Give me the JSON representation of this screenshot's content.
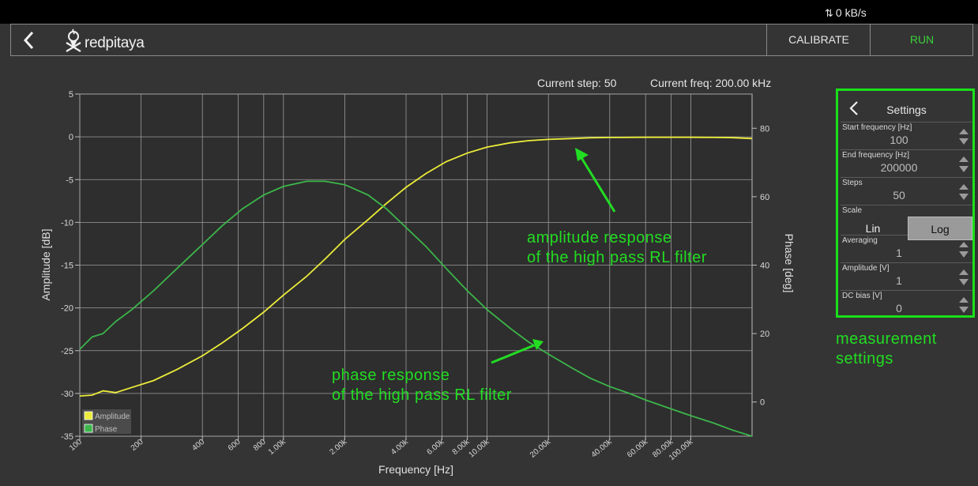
{
  "netrate": {
    "text": "0 kB/s"
  },
  "toolbar": {
    "logo_text": "redpitaya",
    "calibrate_label": "CALIBRATE",
    "run_label": "RUN",
    "run_color": "#3ad13a"
  },
  "status": {
    "current_step": "Current step: 50",
    "current_freq": "Current freq: 200.00 kHz"
  },
  "settings": {
    "title": "Settings",
    "start_frequency": {
      "label": "Start frequency [Hz]",
      "value": "100"
    },
    "end_frequency": {
      "label": "End frequency [Hz]",
      "value": "200000"
    },
    "steps": {
      "label": "Steps",
      "value": "50"
    },
    "scale": {
      "label": "Scale",
      "options": [
        "Lin",
        "Log"
      ],
      "selected": "Log"
    },
    "averaging": {
      "label": "Averaging",
      "value": "1"
    },
    "amplitude": {
      "label": "Amplitude [V]",
      "value": "1"
    },
    "dc_bias": {
      "label": "DC bias [V]",
      "value": "0"
    },
    "border_color": "#19e019"
  },
  "annotations": {
    "amplitude_line1": "amplitude response",
    "amplitude_line2": "of the high pass RL filter",
    "phase_line1": "phase response",
    "phase_line2": "of the high pass RL filter",
    "settings_line1": "measurement",
    "settings_line2": "settings",
    "color": "#22dd22"
  },
  "chart_data": {
    "type": "line",
    "xlabel": "Frequency [Hz]",
    "ylabel": "Amplitude [dB]",
    "y2label": "Phase [deg]",
    "xscale": "log",
    "xlim": [
      100,
      200000
    ],
    "ylim": [
      -35,
      5
    ],
    "y2lim": [
      -10,
      90
    ],
    "grid": true,
    "legend_position": "bottom-left",
    "x_ticks": [
      {
        "v": 100,
        "label": "100"
      },
      {
        "v": 200,
        "label": "200"
      },
      {
        "v": 400,
        "label": "400"
      },
      {
        "v": 600,
        "label": "600"
      },
      {
        "v": 800,
        "label": "800"
      },
      {
        "v": 1000,
        "label": "1.00k"
      },
      {
        "v": 2000,
        "label": "2.00k"
      },
      {
        "v": 4000,
        "label": "4.00k"
      },
      {
        "v": 6000,
        "label": "6.00k"
      },
      {
        "v": 8000,
        "label": "8.00k"
      },
      {
        "v": 10000,
        "label": "10.00k"
      },
      {
        "v": 20000,
        "label": "20.00k"
      },
      {
        "v": 40000,
        "label": "40.00k"
      },
      {
        "v": 60000,
        "label": "60.00k"
      },
      {
        "v": 80000,
        "label": "80.00k"
      },
      {
        "v": 100000,
        "label": "100.00k"
      }
    ],
    "y_ticks": [
      5,
      0,
      -5,
      -10,
      -15,
      -20,
      -25,
      -30,
      -35
    ],
    "y2_ticks": [
      80,
      60,
      40,
      20,
      0
    ],
    "series": [
      {
        "name": "Amplitude",
        "axis": "left",
        "color": "#ecec3a",
        "points": [
          [
            100,
            -30.3
          ],
          [
            115,
            -30.2
          ],
          [
            130,
            -29.7
          ],
          [
            150,
            -29.9
          ],
          [
            180,
            -29.3
          ],
          [
            230,
            -28.5
          ],
          [
            300,
            -27.2
          ],
          [
            400,
            -25.6
          ],
          [
            500,
            -24.1
          ],
          [
            630,
            -22.4
          ],
          [
            800,
            -20.5
          ],
          [
            1000,
            -18.5
          ],
          [
            1300,
            -16.3
          ],
          [
            1600,
            -14.3
          ],
          [
            2000,
            -12.0
          ],
          [
            2600,
            -9.7
          ],
          [
            3200,
            -7.8
          ],
          [
            4000,
            -5.9
          ],
          [
            5000,
            -4.3
          ],
          [
            6300,
            -2.9
          ],
          [
            8000,
            -1.9
          ],
          [
            10000,
            -1.2
          ],
          [
            13000,
            -0.7
          ],
          [
            16000,
            -0.45
          ],
          [
            20000,
            -0.3
          ],
          [
            26000,
            -0.2
          ],
          [
            32000,
            -0.12
          ],
          [
            40000,
            -0.08
          ],
          [
            60000,
            -0.05
          ],
          [
            80000,
            -0.05
          ],
          [
            100000,
            -0.05
          ],
          [
            130000,
            -0.07
          ],
          [
            160000,
            -0.1
          ],
          [
            200000,
            -0.2
          ]
        ]
      },
      {
        "name": "Phase",
        "axis": "right",
        "color": "#3cb64a",
        "points": [
          [
            100,
            15.4
          ],
          [
            115,
            19.0
          ],
          [
            130,
            20.0
          ],
          [
            150,
            23.5
          ],
          [
            180,
            27.0
          ],
          [
            230,
            32.5
          ],
          [
            300,
            39.0
          ],
          [
            400,
            46.0
          ],
          [
            500,
            51.5
          ],
          [
            630,
            56.5
          ],
          [
            800,
            60.5
          ],
          [
            1000,
            63.0
          ],
          [
            1300,
            64.5
          ],
          [
            1600,
            64.5
          ],
          [
            2000,
            63.5
          ],
          [
            2600,
            60.5
          ],
          [
            3200,
            56.5
          ],
          [
            4000,
            51.0
          ],
          [
            5000,
            45.5
          ],
          [
            6300,
            39.0
          ],
          [
            8000,
            32.5
          ],
          [
            10000,
            27.0
          ],
          [
            13000,
            21.5
          ],
          [
            16000,
            17.5
          ],
          [
            20000,
            14.0
          ],
          [
            26000,
            10.0
          ],
          [
            32000,
            7.0
          ],
          [
            40000,
            4.5
          ],
          [
            50000,
            2.5
          ],
          [
            60000,
            0.6
          ],
          [
            80000,
            -2.0
          ],
          [
            100000,
            -4.0
          ],
          [
            130000,
            -6.2
          ],
          [
            160000,
            -8.2
          ],
          [
            200000,
            -10.0
          ]
        ]
      }
    ]
  }
}
